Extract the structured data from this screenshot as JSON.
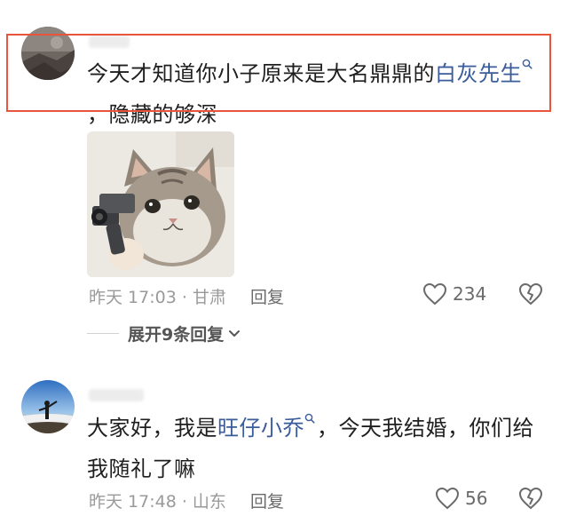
{
  "comments": [
    {
      "text_before": "今天才知道你小子原来是大名鼎鼎的",
      "link": "白灰先生",
      "text_after": "，隐藏的够深",
      "meta": "昨天 17:03 · 甘肃",
      "reply_label": "回复",
      "likes": "234",
      "replies_toggle": "展开9条回复"
    },
    {
      "text_before": "大家好，我是",
      "link": "旺仔小乔",
      "text_after": "，今天我结婚，你们给我随礼了嘛",
      "meta": "昨天 17:48 · 山东",
      "reply_label": "回复",
      "likes": "56"
    }
  ],
  "icons": {
    "like": "heart-outline-icon",
    "dislike": "broken-heart-icon",
    "search": "search-icon",
    "expand": "chevron-down-icon"
  },
  "colors": {
    "link": "#3a5c9b",
    "highlight_box": "#e8553c",
    "meta": "#9a9a9a"
  }
}
